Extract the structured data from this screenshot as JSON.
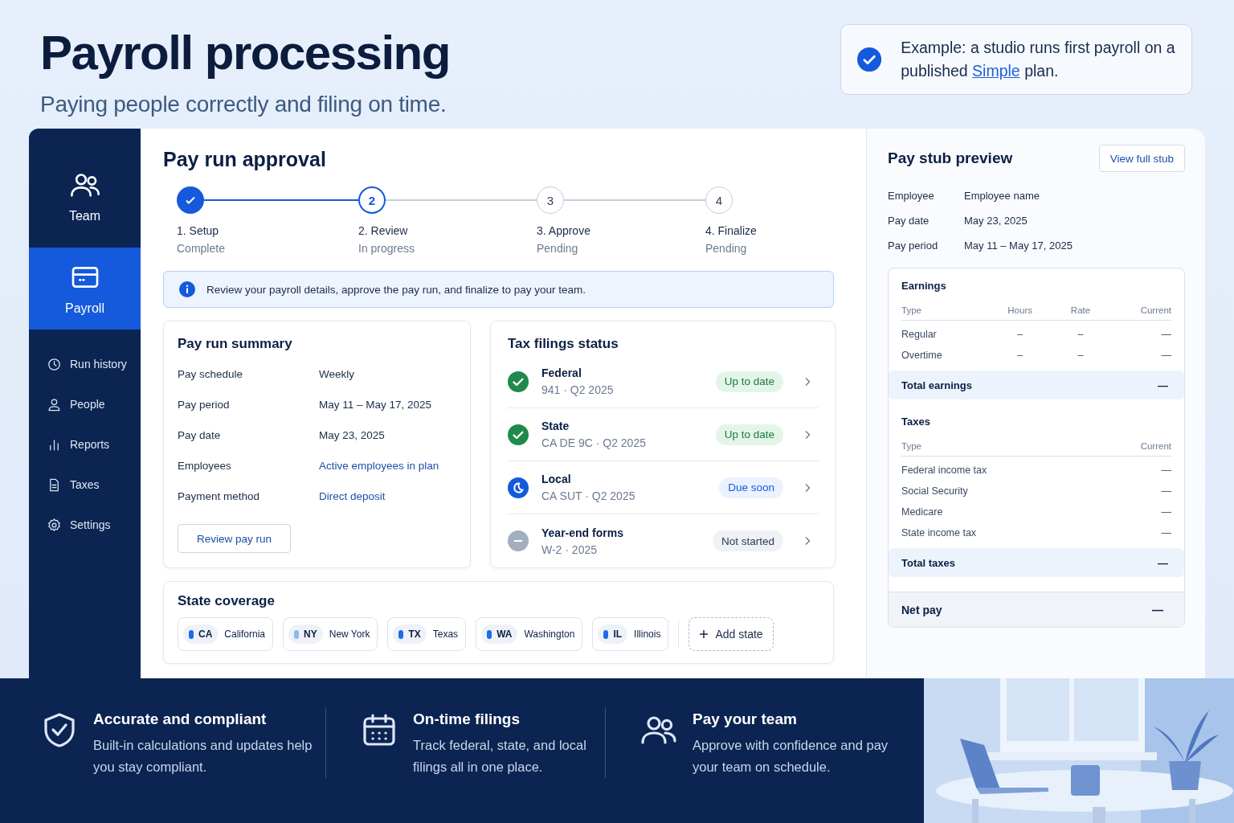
{
  "hero": {
    "title": "Payroll processing",
    "subtitle": "Paying people correctly and filing on time.",
    "callout": {
      "text": "Example: a studio runs first payroll on a published",
      "link": "Simple",
      "after": "plan."
    }
  },
  "sidebar": {
    "items": [
      {
        "label": "Team",
        "kind": "large",
        "selected": false
      },
      {
        "label": "Payroll",
        "kind": "large",
        "selected": true
      },
      {
        "label": "Run history",
        "kind": "small",
        "selected": false
      },
      {
        "label": "People",
        "kind": "small",
        "selected": false
      },
      {
        "label": "Reports",
        "kind": "small",
        "selected": false
      },
      {
        "label": "Taxes",
        "kind": "small",
        "selected": false
      },
      {
        "label": "Settings",
        "kind": "small",
        "selected": false
      }
    ]
  },
  "main": {
    "title": "Pay run approval",
    "steps": [
      {
        "label": "1. Setup",
        "status_text": "Complete",
        "kind": "complete"
      },
      {
        "marker": "2",
        "label": "2. Review",
        "status_text": "In progress",
        "kind": "current"
      },
      {
        "marker": "3",
        "label": "3. Approve",
        "status_text": "Pending",
        "kind": "pending"
      },
      {
        "marker": "4",
        "label": "4. Finalize",
        "status_text": "Pending",
        "kind": "pending"
      }
    ],
    "info": "Review your payroll details, approve the pay run, and finalize to pay your team.",
    "summary": {
      "title": "Pay run summary",
      "rows": [
        {
          "label": "Pay schedule",
          "value": "Weekly"
        },
        {
          "label": "Pay period",
          "value": "May 11 – May 17, 2025"
        },
        {
          "label": "Pay date",
          "value": "May 23, 2025"
        },
        {
          "label": "Employees",
          "value": "Active employees in plan",
          "kind": "link"
        },
        {
          "label": "Payment method",
          "value": "Direct deposit",
          "kind": "link"
        }
      ],
      "button": "Review pay run"
    },
    "filings": {
      "title": "Tax filings status",
      "items": [
        {
          "name": "Federal",
          "detail": "941 · Q2 2025",
          "status": "Up to date",
          "kind": "ok"
        },
        {
          "name": "State",
          "detail": "CA DE 9C · Q2 2025",
          "status": "Up to date",
          "kind": "ok"
        },
        {
          "name": "Local",
          "detail": "CA SUT · Q2 2025",
          "status": "Due soon",
          "kind": "due"
        },
        {
          "name": "Year-end forms",
          "detail": "W-2 · 2025",
          "status": "Not started",
          "kind": "idle"
        }
      ]
    },
    "coverage": {
      "title": "State coverage",
      "states": [
        {
          "code": "CA",
          "name": "California",
          "color": "#1f6ae8"
        },
        {
          "code": "NY",
          "name": "New York",
          "color": "#8db6f2"
        },
        {
          "code": "TX",
          "name": "Texas",
          "color": "#1f6ae8"
        },
        {
          "code": "WA",
          "name": "Washington",
          "color": "#1f6ae8"
        },
        {
          "code": "IL",
          "name": "Illinois",
          "color": "#1f6ae8"
        }
      ],
      "add": "Add state"
    }
  },
  "stub": {
    "title": "Pay stub preview",
    "button": "View full stub",
    "fields": [
      {
        "label": "Employee",
        "value": "Employee name"
      },
      {
        "label": "Pay date",
        "value": "May 23, 2025"
      },
      {
        "label": "Pay period",
        "value": "May 11 – May 17, 2025"
      }
    ],
    "sections": [
      {
        "title": "Earnings",
        "columns": [
          "Type",
          "Hours",
          "Rate",
          "Current"
        ],
        "rows": [
          [
            "Regular",
            "–",
            "–",
            "—"
          ],
          [
            "Overtime",
            "–",
            "–",
            "—"
          ]
        ],
        "total": {
          "label": "Total earnings",
          "value": "—"
        }
      },
      {
        "title": "Taxes",
        "columns": [
          "Type",
          "Current"
        ],
        "rows": [
          [
            "Federal income tax",
            "—"
          ],
          [
            "Social Security",
            "—"
          ],
          [
            "Medicare",
            "—"
          ],
          [
            "State income tax",
            "—"
          ]
        ],
        "total": {
          "label": "Total taxes",
          "value": "—"
        }
      }
    ],
    "net": {
      "label": "Net pay",
      "value": "—"
    }
  },
  "features": [
    {
      "title": "Accurate and compliant",
      "text": "Built-in calculations and updates help you stay compliant."
    },
    {
      "title": "On-time filings",
      "text": "Track federal, state, and local filings all in one place."
    },
    {
      "title": "Pay your team",
      "text": "Approve with confidence and pay your team on schedule."
    }
  ]
}
